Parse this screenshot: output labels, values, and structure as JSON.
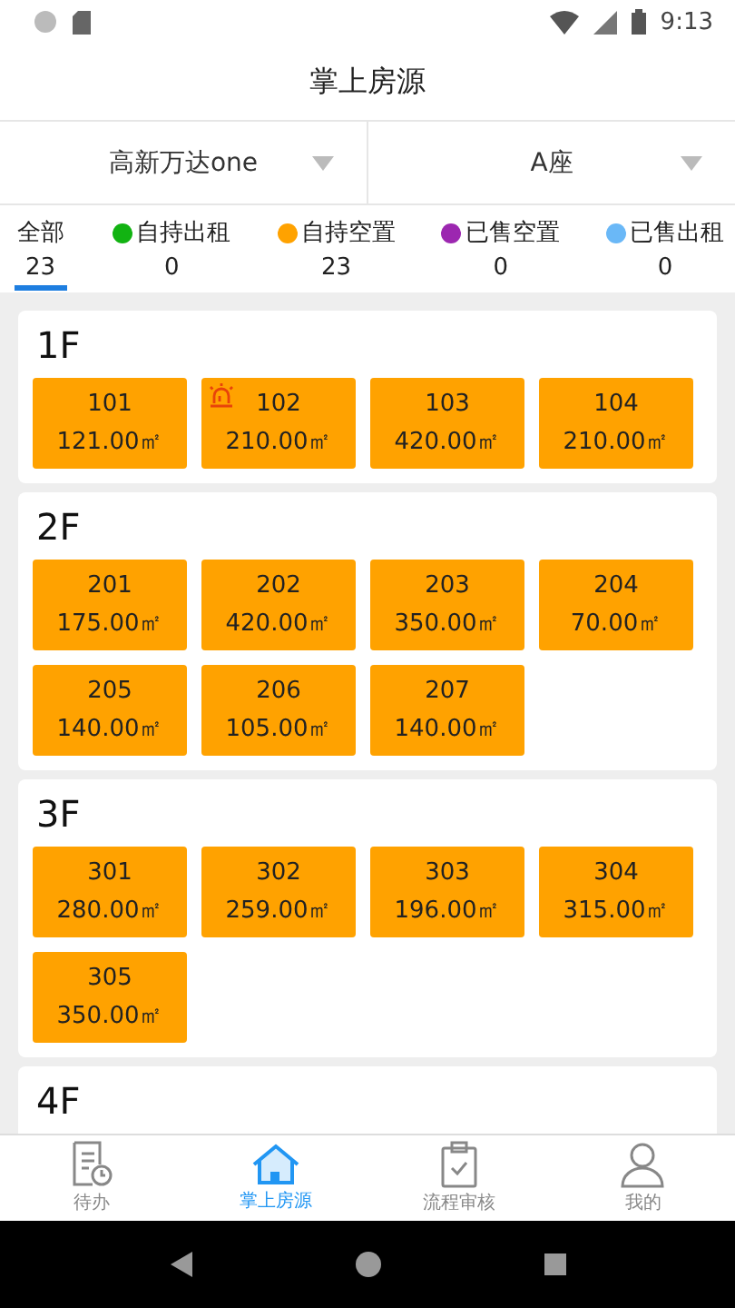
{
  "status_bar": {
    "time": "9:13"
  },
  "title": "掌上房源",
  "selectors": [
    {
      "value": "高新万达one"
    },
    {
      "value": "A座"
    }
  ],
  "filters": [
    {
      "label": "全部",
      "count": "23",
      "selected": true
    },
    {
      "label": "自持出租",
      "count": "0",
      "color": "#12b312",
      "selected": false
    },
    {
      "label": "自持空置",
      "count": "23",
      "color": "#ffa200",
      "selected": false
    },
    {
      "label": "已售空置",
      "count": "0",
      "color": "#9c27b0",
      "selected": false
    },
    {
      "label": "已售出租",
      "count": "0",
      "color": "#6ab8f7",
      "selected": false
    }
  ],
  "floors": [
    {
      "name": "1F",
      "units": [
        {
          "number": "101",
          "area": "121.00㎡",
          "color": "#ffa200",
          "alarm": false
        },
        {
          "number": "102",
          "area": "210.00㎡",
          "color": "#ffa200",
          "alarm": true
        },
        {
          "number": "103",
          "area": "420.00㎡",
          "color": "#ffa200",
          "alarm": false
        },
        {
          "number": "104",
          "area": "210.00㎡",
          "color": "#ffa200",
          "alarm": false
        }
      ]
    },
    {
      "name": "2F",
      "units": [
        {
          "number": "201",
          "area": "175.00㎡",
          "color": "#ffa200",
          "alarm": false
        },
        {
          "number": "202",
          "area": "420.00㎡",
          "color": "#ffa200",
          "alarm": false
        },
        {
          "number": "203",
          "area": "350.00㎡",
          "color": "#ffa200",
          "alarm": false
        },
        {
          "number": "204",
          "area": "70.00㎡",
          "color": "#ffa200",
          "alarm": false
        },
        {
          "number": "205",
          "area": "140.00㎡",
          "color": "#ffa200",
          "alarm": false
        },
        {
          "number": "206",
          "area": "105.00㎡",
          "color": "#ffa200",
          "alarm": false
        },
        {
          "number": "207",
          "area": "140.00㎡",
          "color": "#ffa200",
          "alarm": false
        }
      ]
    },
    {
      "name": "3F",
      "units": [
        {
          "number": "301",
          "area": "280.00㎡",
          "color": "#ffa200",
          "alarm": false
        },
        {
          "number": "302",
          "area": "259.00㎡",
          "color": "#ffa200",
          "alarm": false
        },
        {
          "number": "303",
          "area": "196.00㎡",
          "color": "#ffa200",
          "alarm": false
        },
        {
          "number": "304",
          "area": "315.00㎡",
          "color": "#ffa200",
          "alarm": false
        },
        {
          "number": "305",
          "area": "350.00㎡",
          "color": "#ffa200",
          "alarm": false
        }
      ]
    },
    {
      "name": "4F"
    }
  ],
  "bottom_nav": [
    {
      "kind": "todo",
      "label": "待办",
      "selected": false
    },
    {
      "kind": "home",
      "label": "掌上房源",
      "selected": true
    },
    {
      "kind": "review",
      "label": "流程审核",
      "selected": false
    },
    {
      "kind": "profile",
      "label": "我的",
      "selected": false
    }
  ]
}
